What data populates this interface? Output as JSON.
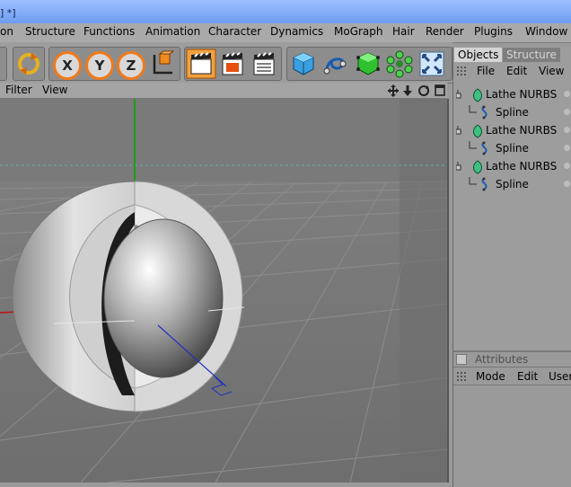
{
  "window": {
    "title": "] *]"
  },
  "menu": [
    "on",
    "Structure",
    "Functions",
    "Animation",
    "Character",
    "Dynamics",
    "MoGraph",
    "Hair",
    "Render",
    "Plugins",
    "Window"
  ],
  "toolbar": {
    "axis_x": "X",
    "axis_y": "Y",
    "axis_z": "Z",
    "icons": [
      "rotate-icon",
      "x-axis-lock-icon",
      "y-axis-lock-icon",
      "z-axis-lock-icon",
      "coordinate-system-icon",
      "render-view-icon",
      "render-picture-viewer-icon",
      "render-settings-icon",
      "cube-primitive-icon",
      "spline-icon",
      "nurbs-icon",
      "array-icon",
      "deformer-icon"
    ]
  },
  "viewport": {
    "menu": [
      "Filter",
      "View"
    ],
    "nav_icons": [
      "move-view-icon",
      "zoom-view-icon",
      "rotate-view-icon",
      "maximize-view-icon"
    ],
    "colors": {
      "background": "#767676",
      "y_axis": "#1e9e1e",
      "x_axis": "#c01010",
      "z_axis": "#2030c0"
    }
  },
  "objects_panel": {
    "tabs": [
      "Objects",
      "Structure"
    ],
    "menu": [
      "File",
      "Edit",
      "View"
    ],
    "items": [
      {
        "label": "Lathe NURBS",
        "level": 0
      },
      {
        "label": "Spline",
        "level": 1
      },
      {
        "label": "Lathe NURBS",
        "level": 0
      },
      {
        "label": "Spline",
        "level": 1
      },
      {
        "label": "Lathe NURBS",
        "level": 0
      },
      {
        "label": "Spline",
        "level": 1
      }
    ]
  },
  "attributes_panel": {
    "title": "Attributes",
    "menu": [
      "Mode",
      "Edit",
      "User"
    ]
  }
}
